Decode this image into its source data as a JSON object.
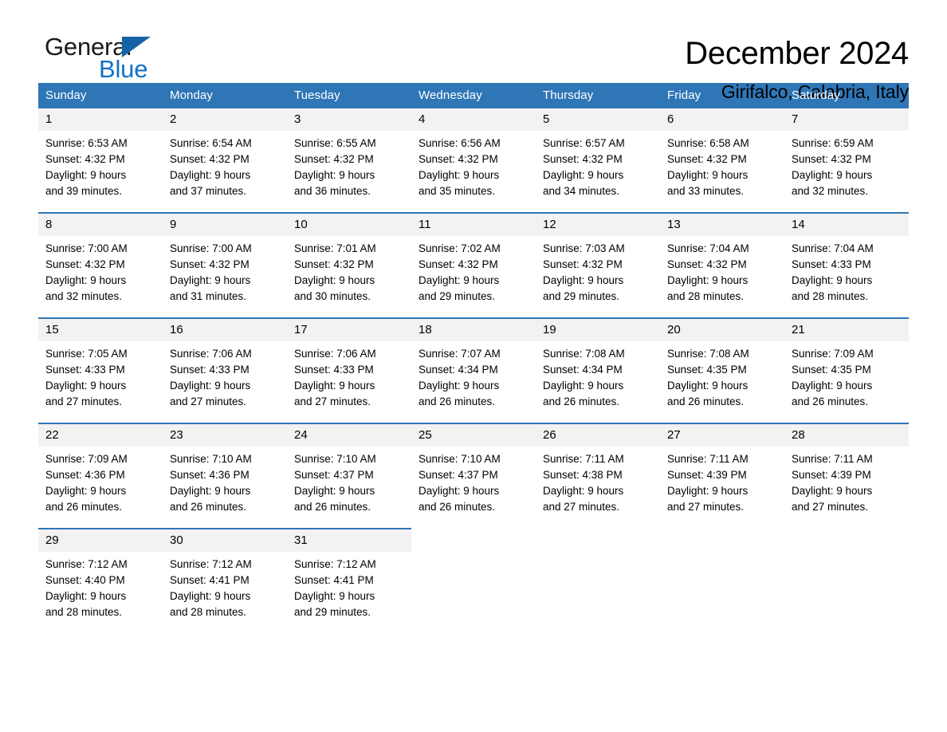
{
  "brand": {
    "name_part1": "General",
    "name_part2": "Blue",
    "triangle_color": "#1464a5",
    "blue_text_color": "#1272c4"
  },
  "header": {
    "title": "December 2024",
    "location": "Girifalco, Calabria, Italy"
  },
  "theme": {
    "header_blue": "#2f76b6",
    "daynum_band": "#f2f2f2"
  },
  "calendar": {
    "weekday_headers": [
      "Sunday",
      "Monday",
      "Tuesday",
      "Wednesday",
      "Thursday",
      "Friday",
      "Saturday"
    ],
    "labels": {
      "sunrise": "Sunrise:",
      "sunset": "Sunset:",
      "daylight": "Daylight:"
    },
    "weeks": [
      [
        {
          "day": "1",
          "sunrise": "Sunrise: 6:53 AM",
          "sunset": "Sunset: 4:32 PM",
          "daylight_1": "Daylight: 9 hours",
          "daylight_2": "and 39 minutes."
        },
        {
          "day": "2",
          "sunrise": "Sunrise: 6:54 AM",
          "sunset": "Sunset: 4:32 PM",
          "daylight_1": "Daylight: 9 hours",
          "daylight_2": "and 37 minutes."
        },
        {
          "day": "3",
          "sunrise": "Sunrise: 6:55 AM",
          "sunset": "Sunset: 4:32 PM",
          "daylight_1": "Daylight: 9 hours",
          "daylight_2": "and 36 minutes."
        },
        {
          "day": "4",
          "sunrise": "Sunrise: 6:56 AM",
          "sunset": "Sunset: 4:32 PM",
          "daylight_1": "Daylight: 9 hours",
          "daylight_2": "and 35 minutes."
        },
        {
          "day": "5",
          "sunrise": "Sunrise: 6:57 AM",
          "sunset": "Sunset: 4:32 PM",
          "daylight_1": "Daylight: 9 hours",
          "daylight_2": "and 34 minutes."
        },
        {
          "day": "6",
          "sunrise": "Sunrise: 6:58 AM",
          "sunset": "Sunset: 4:32 PM",
          "daylight_1": "Daylight: 9 hours",
          "daylight_2": "and 33 minutes."
        },
        {
          "day": "7",
          "sunrise": "Sunrise: 6:59 AM",
          "sunset": "Sunset: 4:32 PM",
          "daylight_1": "Daylight: 9 hours",
          "daylight_2": "and 32 minutes."
        }
      ],
      [
        {
          "day": "8",
          "sunrise": "Sunrise: 7:00 AM",
          "sunset": "Sunset: 4:32 PM",
          "daylight_1": "Daylight: 9 hours",
          "daylight_2": "and 32 minutes."
        },
        {
          "day": "9",
          "sunrise": "Sunrise: 7:00 AM",
          "sunset": "Sunset: 4:32 PM",
          "daylight_1": "Daylight: 9 hours",
          "daylight_2": "and 31 minutes."
        },
        {
          "day": "10",
          "sunrise": "Sunrise: 7:01 AM",
          "sunset": "Sunset: 4:32 PM",
          "daylight_1": "Daylight: 9 hours",
          "daylight_2": "and 30 minutes."
        },
        {
          "day": "11",
          "sunrise": "Sunrise: 7:02 AM",
          "sunset": "Sunset: 4:32 PM",
          "daylight_1": "Daylight: 9 hours",
          "daylight_2": "and 29 minutes."
        },
        {
          "day": "12",
          "sunrise": "Sunrise: 7:03 AM",
          "sunset": "Sunset: 4:32 PM",
          "daylight_1": "Daylight: 9 hours",
          "daylight_2": "and 29 minutes."
        },
        {
          "day": "13",
          "sunrise": "Sunrise: 7:04 AM",
          "sunset": "Sunset: 4:32 PM",
          "daylight_1": "Daylight: 9 hours",
          "daylight_2": "and 28 minutes."
        },
        {
          "day": "14",
          "sunrise": "Sunrise: 7:04 AM",
          "sunset": "Sunset: 4:33 PM",
          "daylight_1": "Daylight: 9 hours",
          "daylight_2": "and 28 minutes."
        }
      ],
      [
        {
          "day": "15",
          "sunrise": "Sunrise: 7:05 AM",
          "sunset": "Sunset: 4:33 PM",
          "daylight_1": "Daylight: 9 hours",
          "daylight_2": "and 27 minutes."
        },
        {
          "day": "16",
          "sunrise": "Sunrise: 7:06 AM",
          "sunset": "Sunset: 4:33 PM",
          "daylight_1": "Daylight: 9 hours",
          "daylight_2": "and 27 minutes."
        },
        {
          "day": "17",
          "sunrise": "Sunrise: 7:06 AM",
          "sunset": "Sunset: 4:33 PM",
          "daylight_1": "Daylight: 9 hours",
          "daylight_2": "and 27 minutes."
        },
        {
          "day": "18",
          "sunrise": "Sunrise: 7:07 AM",
          "sunset": "Sunset: 4:34 PM",
          "daylight_1": "Daylight: 9 hours",
          "daylight_2": "and 26 minutes."
        },
        {
          "day": "19",
          "sunrise": "Sunrise: 7:08 AM",
          "sunset": "Sunset: 4:34 PM",
          "daylight_1": "Daylight: 9 hours",
          "daylight_2": "and 26 minutes."
        },
        {
          "day": "20",
          "sunrise": "Sunrise: 7:08 AM",
          "sunset": "Sunset: 4:35 PM",
          "daylight_1": "Daylight: 9 hours",
          "daylight_2": "and 26 minutes."
        },
        {
          "day": "21",
          "sunrise": "Sunrise: 7:09 AM",
          "sunset": "Sunset: 4:35 PM",
          "daylight_1": "Daylight: 9 hours",
          "daylight_2": "and 26 minutes."
        }
      ],
      [
        {
          "day": "22",
          "sunrise": "Sunrise: 7:09 AM",
          "sunset": "Sunset: 4:36 PM",
          "daylight_1": "Daylight: 9 hours",
          "daylight_2": "and 26 minutes."
        },
        {
          "day": "23",
          "sunrise": "Sunrise: 7:10 AM",
          "sunset": "Sunset: 4:36 PM",
          "daylight_1": "Daylight: 9 hours",
          "daylight_2": "and 26 minutes."
        },
        {
          "day": "24",
          "sunrise": "Sunrise: 7:10 AM",
          "sunset": "Sunset: 4:37 PM",
          "daylight_1": "Daylight: 9 hours",
          "daylight_2": "and 26 minutes."
        },
        {
          "day": "25",
          "sunrise": "Sunrise: 7:10 AM",
          "sunset": "Sunset: 4:37 PM",
          "daylight_1": "Daylight: 9 hours",
          "daylight_2": "and 26 minutes."
        },
        {
          "day": "26",
          "sunrise": "Sunrise: 7:11 AM",
          "sunset": "Sunset: 4:38 PM",
          "daylight_1": "Daylight: 9 hours",
          "daylight_2": "and 27 minutes."
        },
        {
          "day": "27",
          "sunrise": "Sunrise: 7:11 AM",
          "sunset": "Sunset: 4:39 PM",
          "daylight_1": "Daylight: 9 hours",
          "daylight_2": "and 27 minutes."
        },
        {
          "day": "28",
          "sunrise": "Sunrise: 7:11 AM",
          "sunset": "Sunset: 4:39 PM",
          "daylight_1": "Daylight: 9 hours",
          "daylight_2": "and 27 minutes."
        }
      ],
      [
        {
          "day": "29",
          "sunrise": "Sunrise: 7:12 AM",
          "sunset": "Sunset: 4:40 PM",
          "daylight_1": "Daylight: 9 hours",
          "daylight_2": "and 28 minutes."
        },
        {
          "day": "30",
          "sunrise": "Sunrise: 7:12 AM",
          "sunset": "Sunset: 4:41 PM",
          "daylight_1": "Daylight: 9 hours",
          "daylight_2": "and 28 minutes."
        },
        {
          "day": "31",
          "sunrise": "Sunrise: 7:12 AM",
          "sunset": "Sunset: 4:41 PM",
          "daylight_1": "Daylight: 9 hours",
          "daylight_2": "and 29 minutes."
        },
        {
          "day": "",
          "sunrise": "",
          "sunset": "",
          "daylight_1": "",
          "daylight_2": ""
        },
        {
          "day": "",
          "sunrise": "",
          "sunset": "",
          "daylight_1": "",
          "daylight_2": ""
        },
        {
          "day": "",
          "sunrise": "",
          "sunset": "",
          "daylight_1": "",
          "daylight_2": ""
        },
        {
          "day": "",
          "sunrise": "",
          "sunset": "",
          "daylight_1": "",
          "daylight_2": ""
        }
      ]
    ]
  }
}
